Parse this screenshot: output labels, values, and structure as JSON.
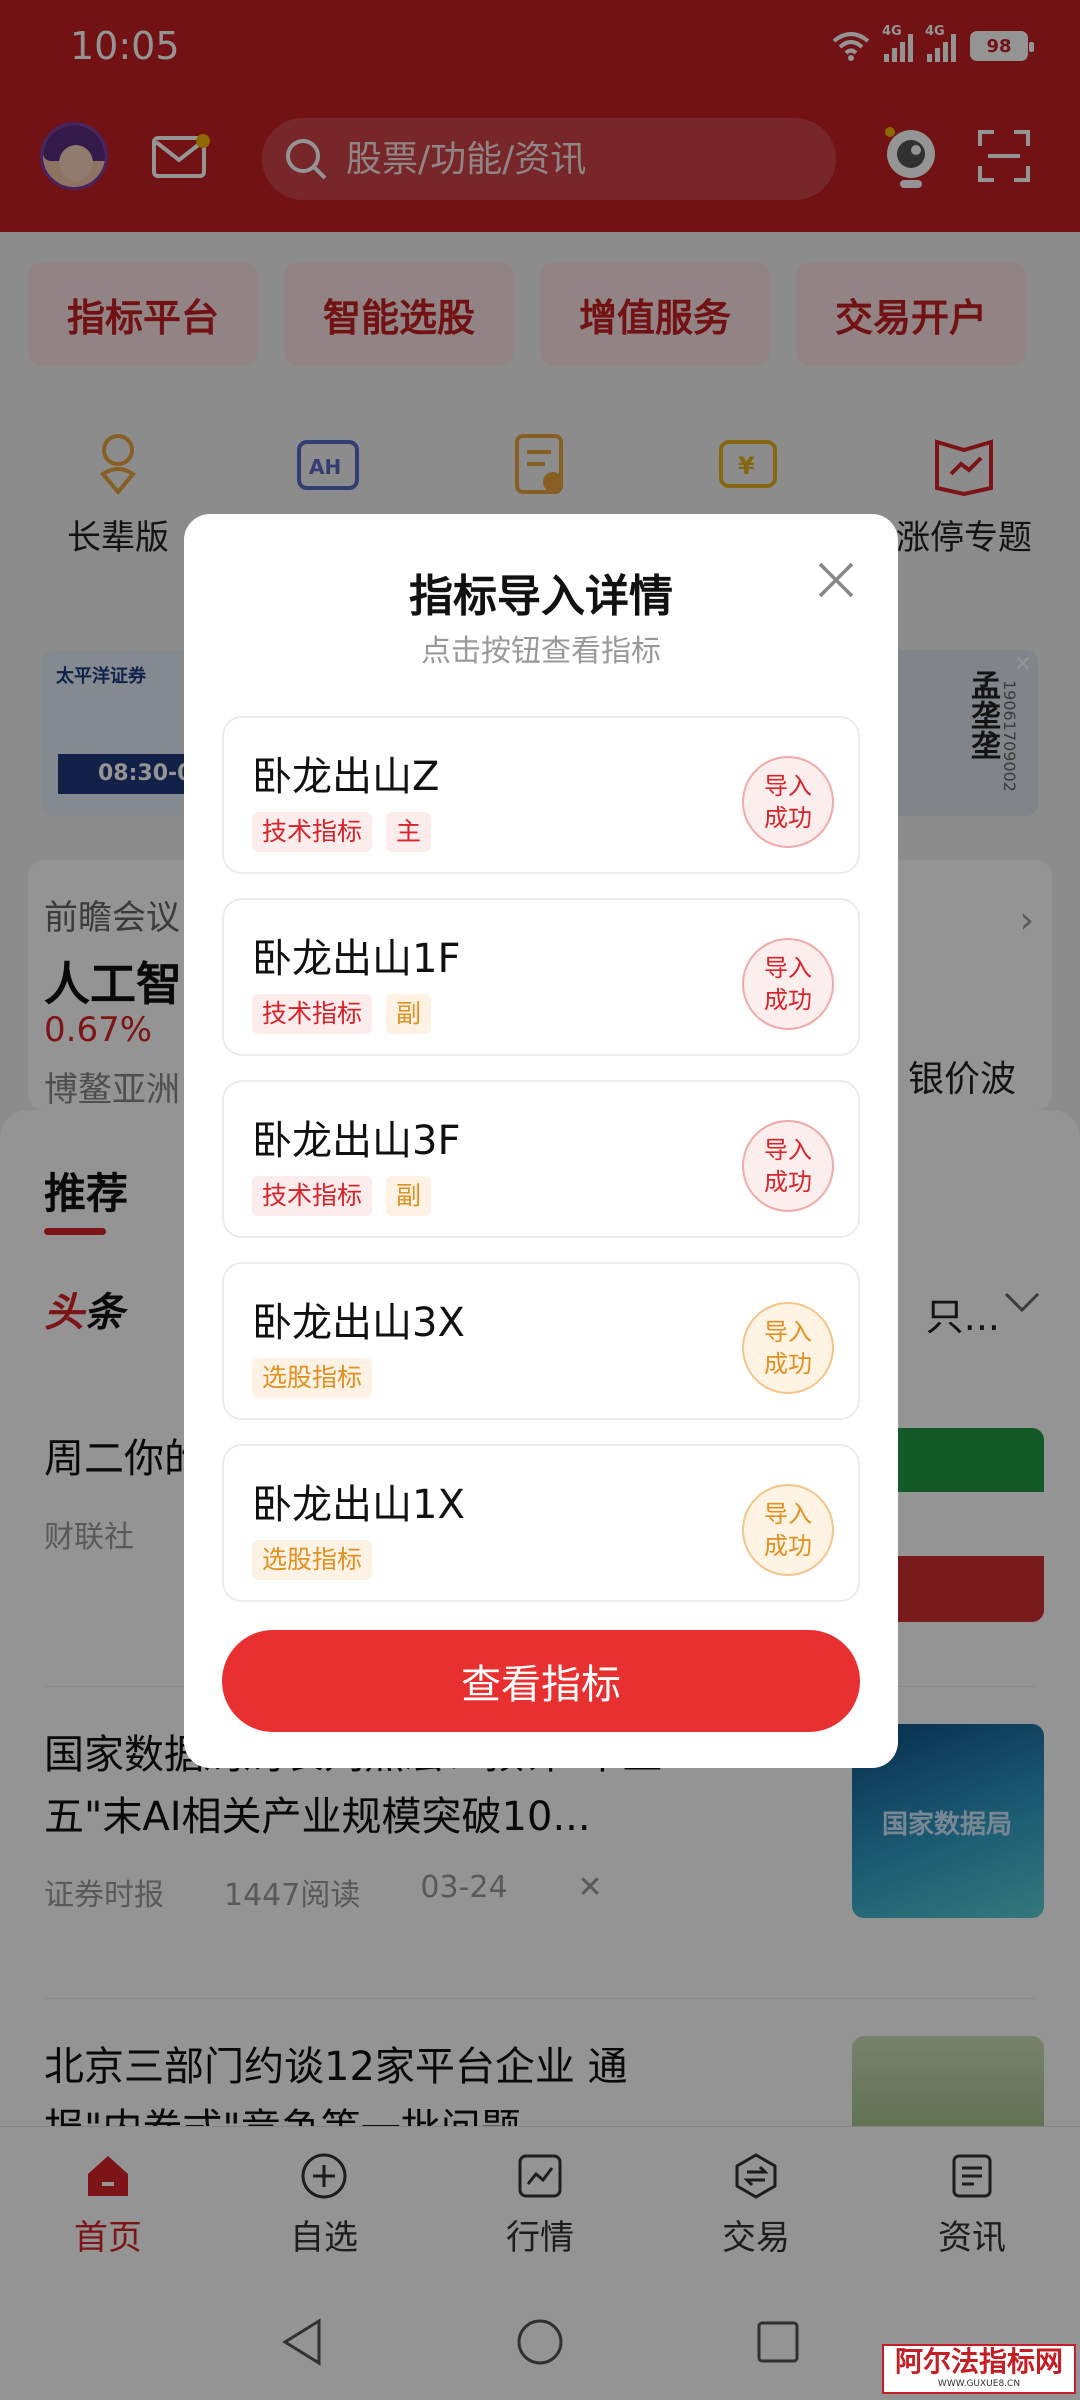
{
  "status_bar": {
    "time": "10:05",
    "sig1": "4G",
    "sig2": "4G",
    "battery": "98"
  },
  "header": {
    "search_placeholder": "股票/功能/资讯"
  },
  "quick_tabs": [
    "指标平台",
    "智能选股",
    "增值服务",
    "交易开户"
  ],
  "features": {
    "f1": "长辈版",
    "f5": "涨停专题"
  },
  "banner": {
    "left_brand": "太平洋证券",
    "left_time": "08:30-09",
    "right_name": "孟垄垄",
    "right_phone": "19061709002"
  },
  "meeting": {
    "title": "前瞻会议",
    "headline": "人工智",
    "pct": "0.67%",
    "sub": "博鳌亚洲",
    "right": "银价波"
  },
  "feed": {
    "tab": "推荐",
    "toutiao_a": "头",
    "toutiao_b": "条",
    "more": "只...",
    "news": [
      {
        "title": "周二你的新闻：投",
        "source": "财联社"
      },
      {
        "title": "国家数据局局长刘烈宏：预计\"十五五\"末AI相关产业规模突破10...",
        "source": "证券时报",
        "reads": "1447阅读",
        "date": "03-24"
      },
      {
        "title": "北京三部门约谈12家平台企业 通报\"内卷式\"竞争等一批问题"
      }
    ],
    "thumb2_text": "国家数据局"
  },
  "bottom_nav": [
    "首页",
    "自选",
    "行情",
    "交易",
    "资讯"
  ],
  "modal": {
    "title": "指标导入详情",
    "subtitle": "点击按钮查看指标",
    "button": "查看指标",
    "items": [
      {
        "name": "卧龙出山Z",
        "tag1": "技术指标",
        "tag2": "主",
        "stamp1": "导入",
        "stamp2": "成功"
      },
      {
        "name": "卧龙出山1F",
        "tag1": "技术指标",
        "tag2": "副",
        "stamp1": "导入",
        "stamp2": "成功"
      },
      {
        "name": "卧龙出山3F",
        "tag1": "技术指标",
        "tag2": "副",
        "stamp1": "导入",
        "stamp2": "成功"
      },
      {
        "name": "卧龙出山3X",
        "tag1": "选股指标",
        "stamp1": "导入",
        "stamp2": "成功"
      },
      {
        "name": "卧龙出山1X",
        "tag1": "选股指标",
        "stamp1": "导入",
        "stamp2": "成功"
      }
    ]
  },
  "watermark": {
    "line1": "阿尔法指标网",
    "line2": "WWW.GUXUE8.CN"
  },
  "colors": {
    "brand_red": "#c41f24",
    "button_red": "#e83030",
    "tag_orange": "#e39021"
  }
}
